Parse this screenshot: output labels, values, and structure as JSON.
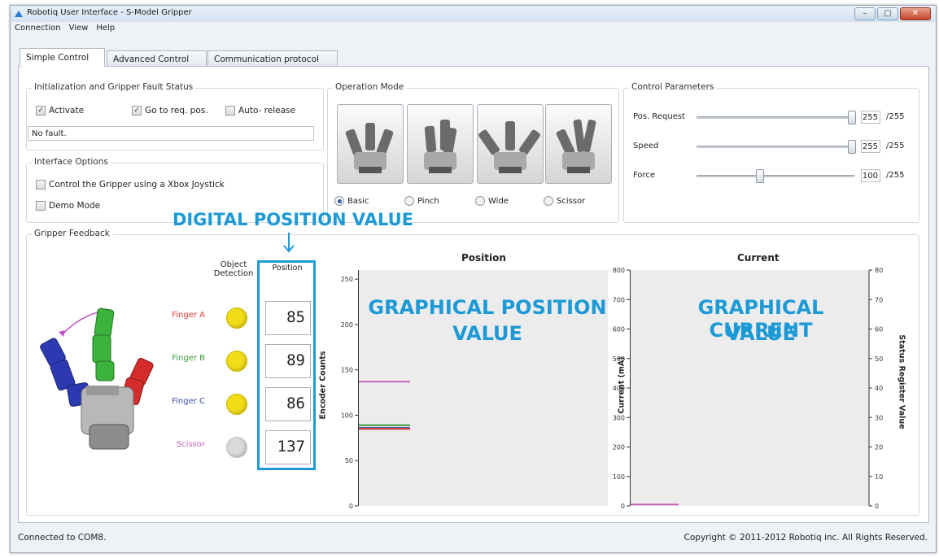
{
  "window": {
    "title": "Robotiq User Interface - S-Model Gripper"
  },
  "menu": [
    "Connection",
    "View",
    "Help"
  ],
  "tabs": [
    "Simple Control",
    "Advanced Control",
    "Communication protocol"
  ],
  "init_group": {
    "title": "Initialization and Gripper Fault Status",
    "activate": {
      "label": "Activate",
      "checked": true
    },
    "go_to_req": {
      "label": "Go to req. pos.",
      "checked": true
    },
    "auto_release": {
      "label": "Auto- release",
      "checked": false
    },
    "fault_text": "No fault."
  },
  "interface_group": {
    "title": "Interface Options",
    "xbox": {
      "label": "Control the Gripper using a Xbox Joystick",
      "checked": false
    },
    "demo": {
      "label": "Demo Mode",
      "checked": false
    }
  },
  "operation_mode": {
    "title": "Operation Mode",
    "options": [
      "Basic",
      "Pinch",
      "Wide",
      "Scissor"
    ],
    "selected": "Basic"
  },
  "control_params": {
    "title": "Control Parameters",
    "params": [
      {
        "label": "Pos. Request",
        "value": "255",
        "max": "/255",
        "fraction": 1.0
      },
      {
        "label": "Speed",
        "value": "255",
        "max": "/255",
        "fraction": 1.0
      },
      {
        "label": "Force",
        "value": "100",
        "max": "/255",
        "fraction": 0.392
      }
    ]
  },
  "feedback": {
    "title": "Gripper Feedback",
    "object_detection_header": "Object Detection",
    "position_header": "Position",
    "fingers": [
      {
        "label": "Finger A",
        "color": "#e2393b",
        "detected": true,
        "position": "85"
      },
      {
        "label": "Finger B",
        "color": "#3d9a3d",
        "detected": true,
        "position": "89"
      },
      {
        "label": "Finger C",
        "color": "#3a4fb0",
        "detected": true,
        "position": "86"
      },
      {
        "label": "Scissor",
        "color": "#c463b8",
        "detected": false,
        "position": "137"
      }
    ]
  },
  "annotations": {
    "digital": "DIGITAL POSITION VALUE",
    "graphical_position_1": "GRAPHICAL POSITION",
    "graphical_position_2": "VALUE",
    "graphical_current_1": "GRAPHICAL CURRENT",
    "graphical_current_2": "VALUE",
    "color": "#1d9ad6"
  },
  "chart_data": [
    {
      "type": "line",
      "title": "Position",
      "ylabel": "Encoder Counts",
      "ylim": [
        0,
        260
      ],
      "yticks": [
        0,
        50,
        100,
        150,
        200,
        250
      ],
      "series": [
        {
          "color": "#c463b8",
          "values": [
            137
          ]
        },
        {
          "color": "#3d9a3d",
          "values": [
            89
          ]
        },
        {
          "color": "#3a4fb0",
          "values": [
            86
          ]
        },
        {
          "color": "#e2393b",
          "values": [
            85
          ]
        }
      ]
    },
    {
      "type": "line",
      "title": "Current",
      "ylabel": "Current (mA)",
      "y2label": "Status Register Value",
      "ylim": [
        0,
        800
      ],
      "y2lim": [
        0,
        80
      ],
      "yticks": [
        0,
        100,
        200,
        300,
        400,
        500,
        600,
        700,
        800
      ],
      "y2ticks": [
        0,
        10,
        20,
        30,
        40,
        50,
        60,
        70,
        80
      ],
      "series": [
        {
          "color": "#c463b8",
          "values": [
            5
          ]
        }
      ]
    }
  ],
  "status": {
    "left": "Connected to COM8.",
    "right": "Copyright © 2011-2012 Robotiq inc. All Rights Reserved."
  }
}
